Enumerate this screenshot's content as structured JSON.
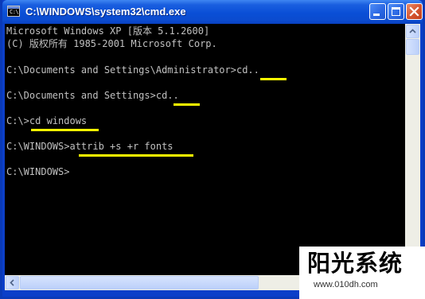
{
  "window": {
    "title": "C:\\WINDOWS\\system32\\cmd.exe",
    "icon_label": "C:\\"
  },
  "console": {
    "lines": [
      "Microsoft Windows XP [版本 5.1.2600]",
      "(C) 版权所有 1985-2001 Microsoft Corp.",
      "",
      "C:\\Documents and Settings\\Administrator>cd..",
      "",
      "C:\\Documents and Settings>cd..",
      "",
      "C:\\>cd windows",
      "",
      "C:\\WINDOWS>attrib +s +r fonts",
      "",
      "C:\\WINDOWS>"
    ],
    "highlight_color": "#ffff00",
    "text_color": "#c0c0c0",
    "background_color": "#000000"
  },
  "watermark": {
    "title": "阳光系统",
    "url": "www.010dh.com"
  },
  "icons": {
    "app": "console-icon",
    "minimize": "minimize-icon",
    "maximize": "maximize-icon",
    "close": "close-icon",
    "scroll_up": "arrow-up-icon",
    "scroll_left": "arrow-left-icon"
  }
}
